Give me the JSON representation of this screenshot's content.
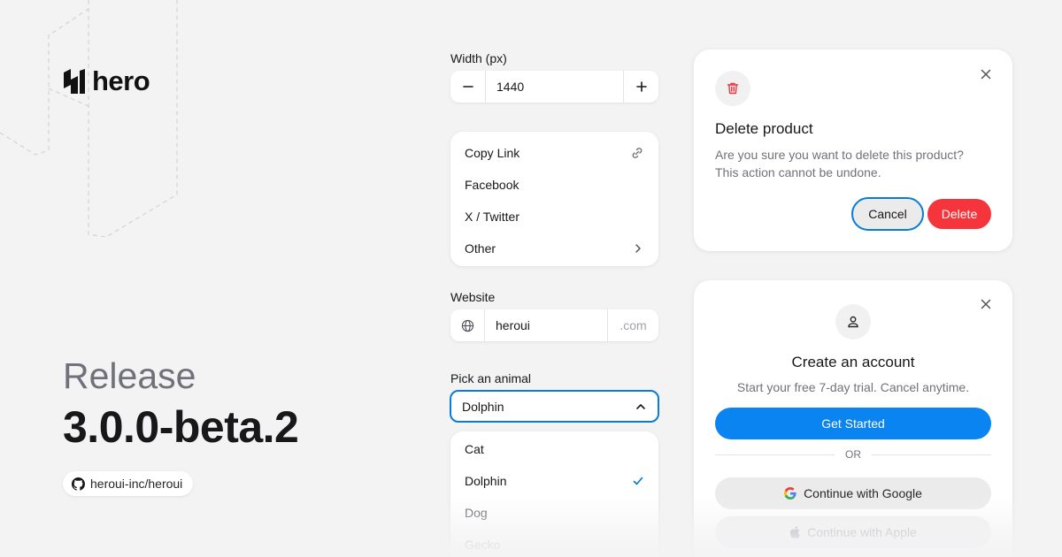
{
  "brand": {
    "name": "hero"
  },
  "release": {
    "label": "Release",
    "version": "3.0.0-beta.2"
  },
  "repo": {
    "label": "heroui-inc/heroui",
    "icon": "github-icon"
  },
  "width_field": {
    "label": "Width (px)",
    "value": "1440",
    "decrement": "−",
    "increment": "+"
  },
  "share_menu": {
    "items": [
      {
        "label": "Copy Link",
        "icon": "link-icon"
      },
      {
        "label": "Facebook"
      },
      {
        "label": "X / Twitter"
      },
      {
        "label": "Other",
        "icon": "chevron-right-icon"
      }
    ]
  },
  "website_field": {
    "label": "Website",
    "value": "heroui",
    "suffix": ".com",
    "icon": "globe-icon"
  },
  "animal_select": {
    "label": "Pick an animal",
    "selected": "Dolphin",
    "options": [
      {
        "label": "Cat",
        "selected": false
      },
      {
        "label": "Dolphin",
        "selected": true
      },
      {
        "label": "Dog",
        "selected": false
      },
      {
        "label": "Gecko",
        "selected": false
      }
    ]
  },
  "delete_dialog": {
    "title": "Delete product",
    "body": "Are you sure you want to delete this product? This action cannot be undone.",
    "cancel": "Cancel",
    "confirm": "Delete",
    "icon": "trash-icon"
  },
  "signup_card": {
    "title": "Create an account",
    "subtitle": "Start your free 7-day trial. Cancel anytime.",
    "primary": "Get Started",
    "divider": "OR",
    "google": "Continue with Google",
    "apple": "Continue with Apple",
    "icon": "user-icon"
  },
  "colors": {
    "accent": "#0a84f0",
    "focus_ring": "#0a7cd6",
    "danger": "#f5343c",
    "background": "#f3f3f4"
  }
}
